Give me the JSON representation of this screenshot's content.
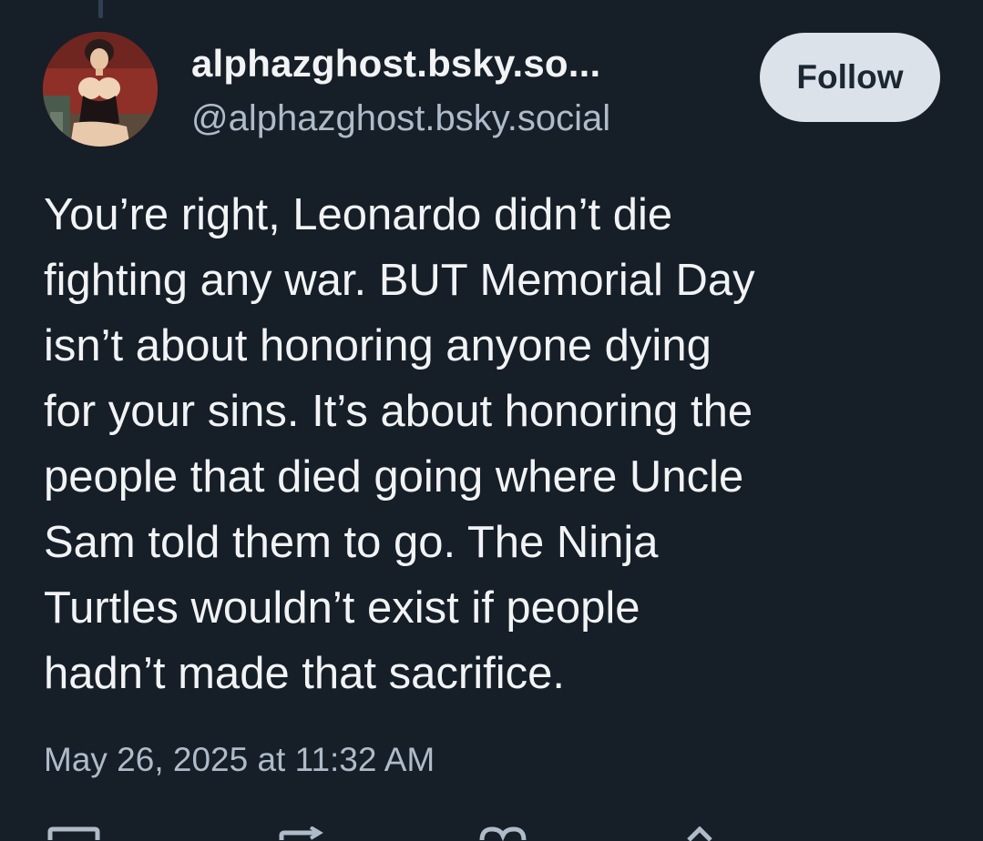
{
  "post": {
    "author": {
      "display_name": "alphazghost.bsky.so...",
      "handle": "@alphazghost.bsky.social",
      "avatar_icon": "profile-avatar-image"
    },
    "follow_label": "Follow",
    "body_lines": [
      "You’re right, Leonardo didn’t die",
      "fighting any war. BUT Memorial Day",
      "isn’t about honoring anyone dying",
      "for your sins. It’s about honoring the",
      "people that died going where Uncle",
      "Sam told them to go. The Ninja",
      "Turtles wouldn’t exist if people",
      "hadn’t made that sacrifice."
    ],
    "timestamp": "May 26, 2025 at 11:32 AM"
  },
  "actions": [
    {
      "icon": "reply-icon"
    },
    {
      "icon": "repost-icon"
    },
    {
      "icon": "like-icon"
    },
    {
      "icon": "share-icon"
    }
  ],
  "colors": {
    "background": "#161e27",
    "text_primary": "#f1f3f5",
    "text_secondary": "#aebbc9",
    "follow_button_bg": "#dce2ea",
    "follow_button_text": "#1b2733"
  }
}
